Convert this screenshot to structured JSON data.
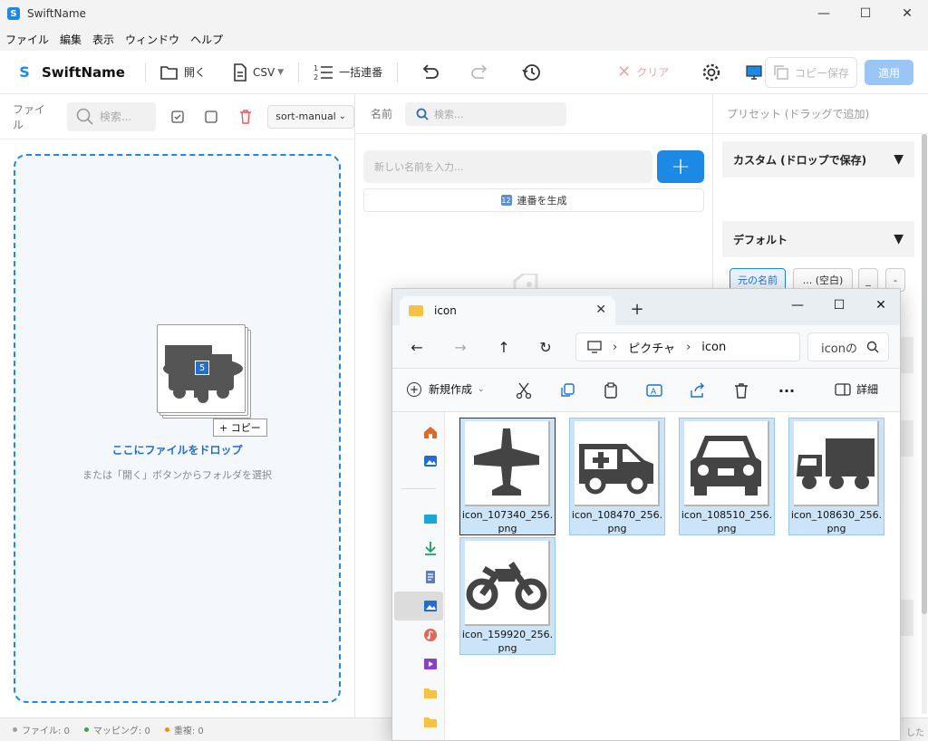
{
  "window": {
    "title": "SwiftName"
  },
  "menu": [
    "ファイル",
    "編集",
    "表示",
    "ウィンドウ",
    "ヘルプ"
  ],
  "toolbar": {
    "brand": "SwiftName",
    "open_label": "開く",
    "csv_label": "CSV",
    "batch_label": "一括連番",
    "clear_label": "クリア",
    "copy_save_label": "コピー保存",
    "apply_label": "適用"
  },
  "left": {
    "header_label": "ファイル",
    "search_placeholder": "検索...",
    "sort_value": "sort-manual",
    "drop_title": "ここにファイルをドロップ",
    "drop_sub": "または「開く」ボタンからフォルダを選択",
    "drag_count": "5",
    "drag_tip": "+ コピー"
  },
  "middle": {
    "header_label": "名前",
    "search_placeholder": "検索...",
    "new_name_placeholder": "新しい名前を入力...",
    "sequence_label": "連番を生成"
  },
  "right": {
    "header_label": "プリセット (ドラッグで追加)",
    "custom_label": "カスタム (ドロップで保存)",
    "default_label": "デフォルト",
    "chips": [
      "元の名前",
      "... (空白)",
      "_",
      "-"
    ]
  },
  "status": {
    "files": "ファイル: 0",
    "mappings": "マッピング: 0",
    "duplicates": "重複: 0",
    "right_text": "した",
    "colors": {
      "files": "#9e9e9e",
      "mappings": "#43a047",
      "duplicates": "#fb8c00"
    }
  },
  "explorer": {
    "tab_title": "icon",
    "breadcrumb": [
      "ピクチャ",
      "icon"
    ],
    "search_value": "iconの",
    "new_label": "新規作成",
    "detail_label": "詳細",
    "files": [
      {
        "name": "icon_107340_256.png",
        "icon": "airplane-icon"
      },
      {
        "name": "icon_108470_256.png",
        "icon": "ambulance-icon"
      },
      {
        "name": "icon_108510_256.png",
        "icon": "car-icon"
      },
      {
        "name": "icon_108630_256.png",
        "icon": "truck-icon"
      },
      {
        "name": "icon_159920_256.png",
        "icon": "motorcycle-icon"
      }
    ]
  }
}
